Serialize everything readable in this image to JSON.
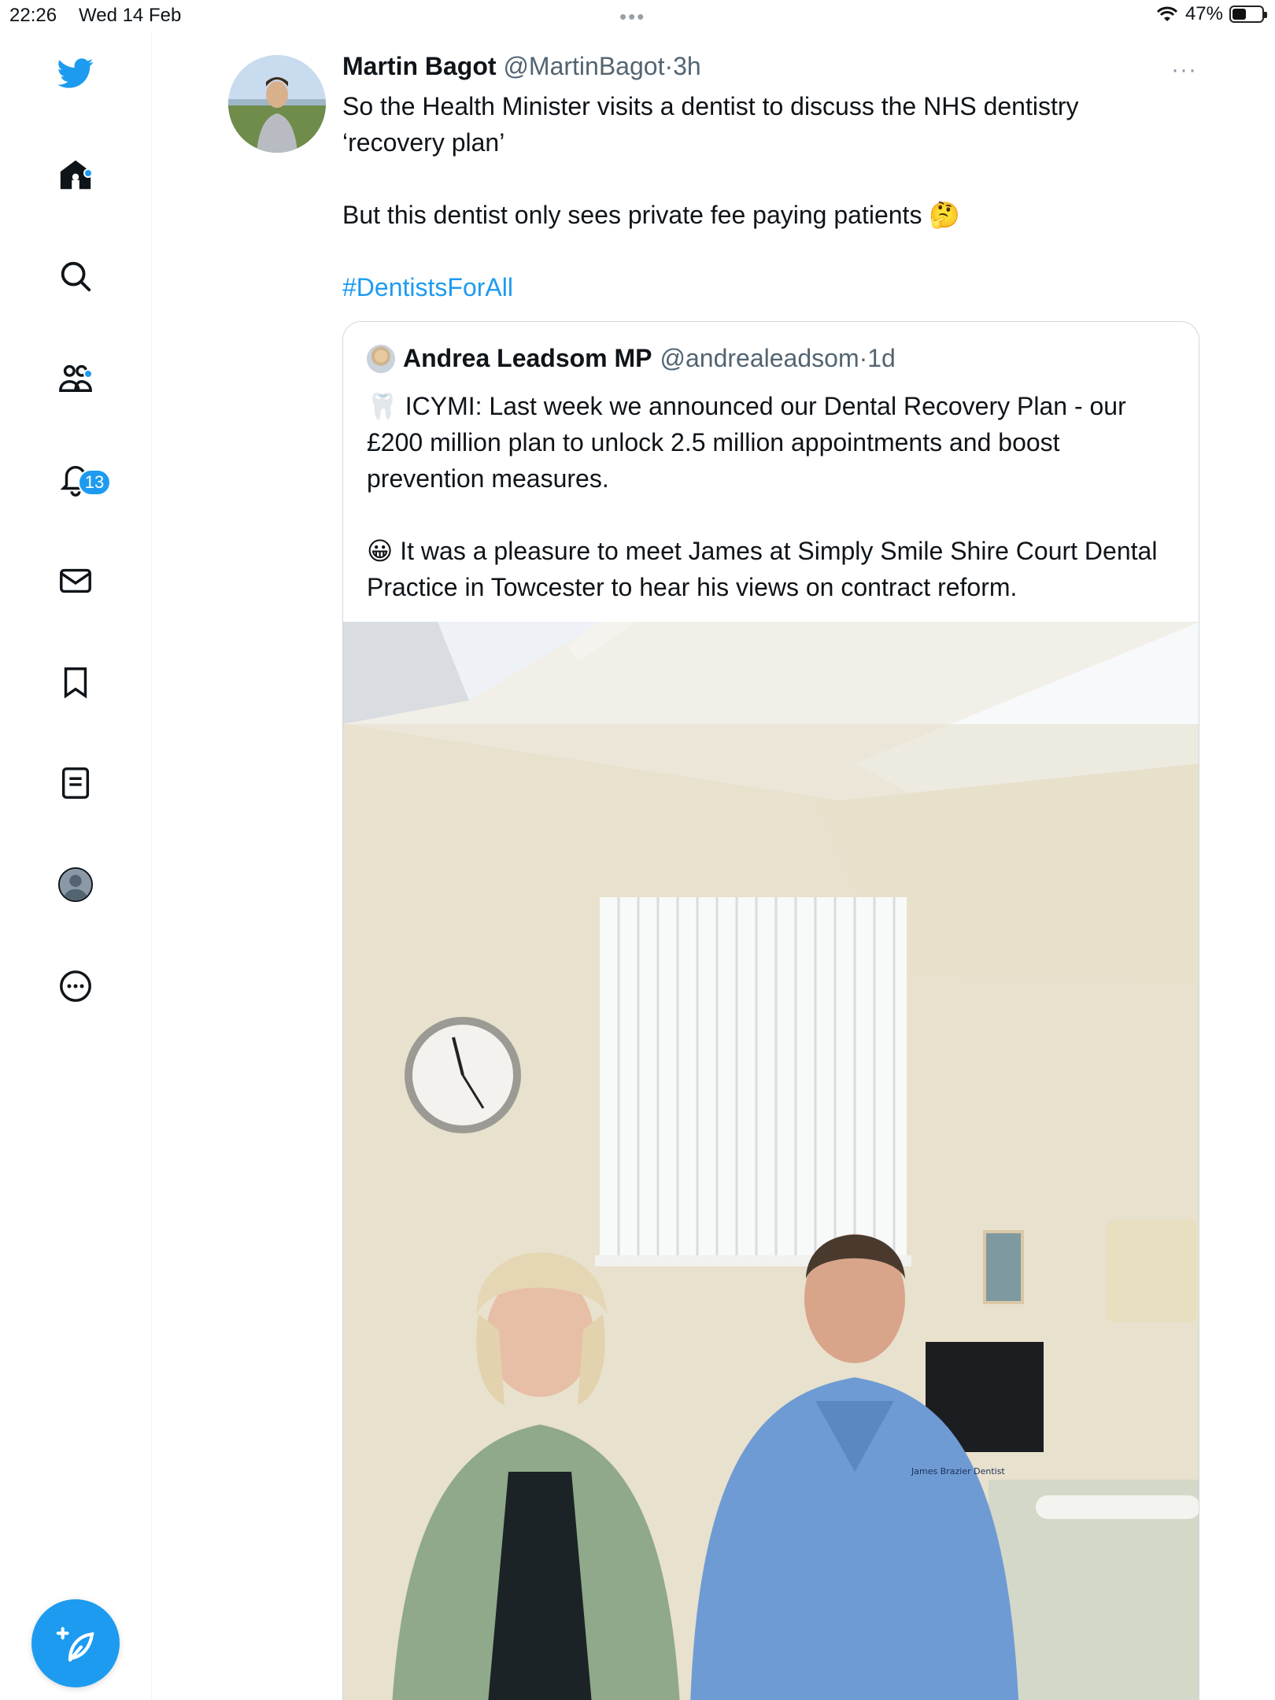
{
  "status_bar": {
    "time": "22:26",
    "date": "Wed 14 Feb",
    "battery_percent": "47%",
    "battery_level": 0.47,
    "wifi_icon": "wifi-icon"
  },
  "sidebar": {
    "accent_color": "#1d9bf0",
    "items": [
      {
        "name": "twitter-logo-icon"
      },
      {
        "name": "home-icon",
        "has_dot": true
      },
      {
        "name": "search-icon"
      },
      {
        "name": "communities-icon",
        "has_dot": true
      },
      {
        "name": "notifications-icon",
        "badge": "13"
      },
      {
        "name": "messages-icon"
      },
      {
        "name": "bookmarks-icon"
      },
      {
        "name": "lists-icon"
      },
      {
        "name": "profile-icon"
      },
      {
        "name": "more-icon"
      }
    ],
    "compose_icon": "compose-tweet-icon"
  },
  "tweet": {
    "author_name": "Martin Bagot",
    "author_handle": "@MartinBagot",
    "separator": "·",
    "time": "3h",
    "paragraph_1": "So the Health Minister visits a dentist to discuss the NHS dentistry ‘recovery plan’",
    "paragraph_2": "But this dentist only sees private fee paying patients",
    "paragraph_2_emoji": "🤔",
    "hashtag": "#DentistsForAll",
    "more_menu": "···"
  },
  "quoted_tweet": {
    "author_name": "Andrea Leadsom MP",
    "author_handle": "@andrealeadsom",
    "separator": "·",
    "time": "1d",
    "paragraph_1_emoji": "🦷",
    "paragraph_1": "ICYMI: Last week we announced our Dental Recovery Plan - our £200 million plan to unlock 2.5 million appointments and boost prevention measures.",
    "paragraph_2_emoji": "😀",
    "paragraph_2": "It was a pleasure to meet James at Simply Smile Shire Court Dental Practice in Towcester to hear his views on contract reform.",
    "photo": {
      "scrub_text": "James Brazier Dentist"
    }
  }
}
